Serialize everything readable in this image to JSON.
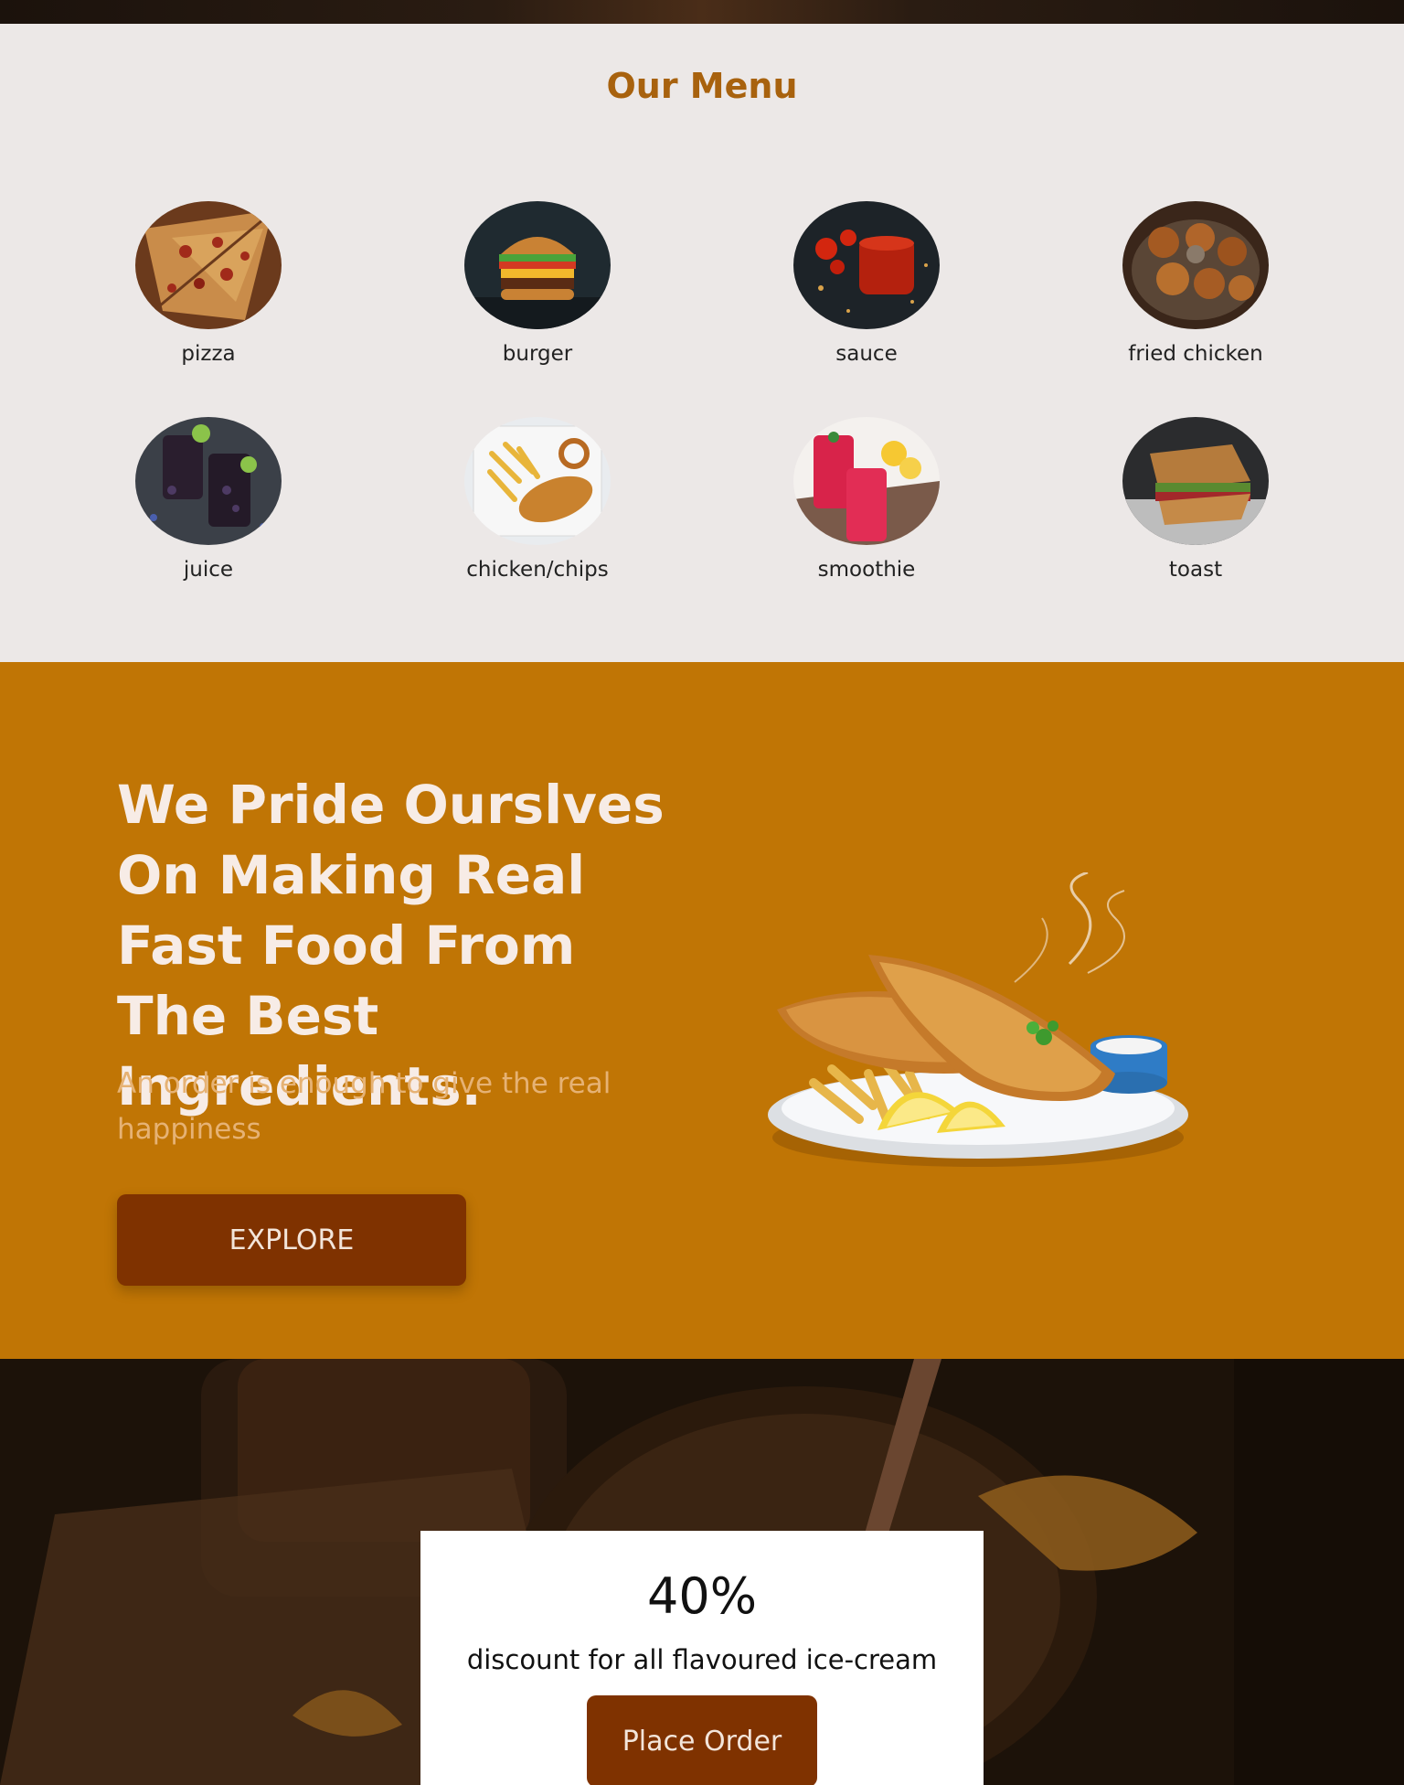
{
  "menu": {
    "title": "Our Menu",
    "items": [
      {
        "label": "pizza",
        "icon": "pizza-image"
      },
      {
        "label": "burger",
        "icon": "burger-image"
      },
      {
        "label": "sauce",
        "icon": "sauce-image"
      },
      {
        "label": "fried chicken",
        "icon": "fried-chicken-image"
      },
      {
        "label": "juice",
        "icon": "juice-image"
      },
      {
        "label": "chicken/chips",
        "icon": "chicken-chips-image"
      },
      {
        "label": "smoothie",
        "icon": "smoothie-image"
      },
      {
        "label": "toast",
        "icon": "toast-image"
      }
    ]
  },
  "promo": {
    "heading": "We Pride Ourslves On Making Real Fast Food From The Best Ingredients.",
    "subtext": "An order is enough to give the real happiness",
    "button_label": "EXPLORE"
  },
  "offer": {
    "percent": "40%",
    "description": "discount for all flavoured ice-cream",
    "button_label": "Place Order"
  },
  "colors": {
    "accent": "#c07505",
    "button": "#7f3200",
    "title": "#a8620e",
    "menu_bg": "#ece8e7"
  }
}
